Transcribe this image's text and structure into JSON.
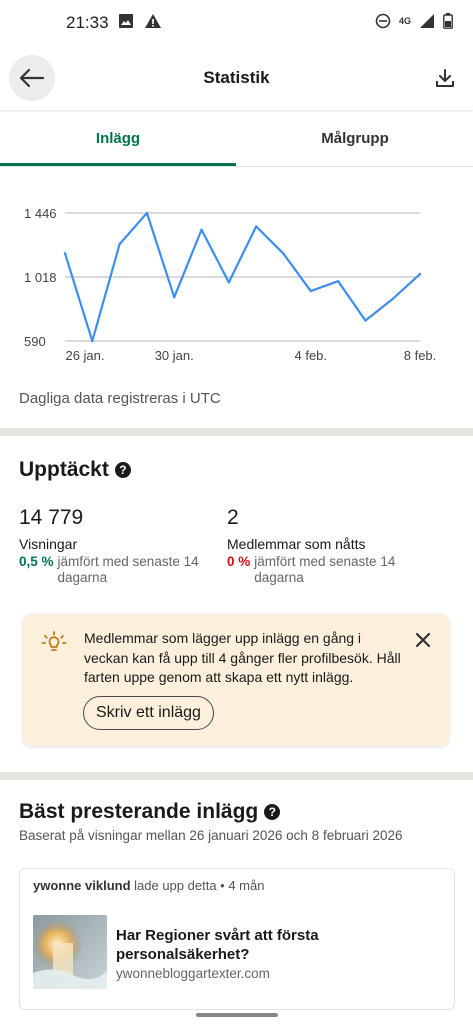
{
  "status": {
    "time": "21:33",
    "network": "4G"
  },
  "appbar": {
    "title": "Statistik"
  },
  "tabs": [
    {
      "label": "Inlägg"
    },
    {
      "label": "Målgrupp"
    }
  ],
  "chart_data": {
    "type": "line",
    "x_ticks": [
      "26 jan.",
      "30 jan.",
      "4 feb.",
      "8 feb."
    ],
    "y_ticks": [
      "1 446",
      "1 018",
      "590"
    ],
    "ylim": [
      590,
      1446
    ],
    "values": [
      1176,
      590,
      1238,
      1446,
      883,
      1334,
      982,
      1356,
      1174,
      924,
      990,
      727,
      871,
      1038
    ],
    "series_color": "#3d8ef0",
    "grid": true
  },
  "utc_note": "Dagliga data registreras i UTC",
  "discovery": {
    "title": "Upptäckt",
    "impressions": {
      "value": "14 779",
      "label": "Visningar",
      "pct": "0,5 %",
      "change": "jämfört med senaste 14 dagarna"
    },
    "reached": {
      "value": "2",
      "label": "Medlemmar som nåtts",
      "pct": "0 %",
      "change": "jämfört med senaste 14 dagarna"
    }
  },
  "tip": {
    "text": "Medlemmar som lägger upp inlägg en gång i veckan kan få upp till 4 gånger fler profilbesök. Håll farten uppe genom att skapa ett nytt inlägg.",
    "button": "Skriv ett inlägg"
  },
  "top_posts": {
    "title": "Bäst presterande inlägg",
    "subtitle": "Baserat på visningar mellan 26 januari 2026 och 8 februari 2026",
    "post": {
      "author": "ywonne viklund",
      "meta": "lade upp detta • 4 mån",
      "title": "Har Regioner svårt att första personalsäkerhet?",
      "source": "ywonnebloggartexter.com"
    }
  },
  "icons": {
    "back": "back-arrow-icon",
    "download": "download-icon",
    "help": "help-icon",
    "tip": "lightbulb-icon",
    "close": "close-icon"
  }
}
